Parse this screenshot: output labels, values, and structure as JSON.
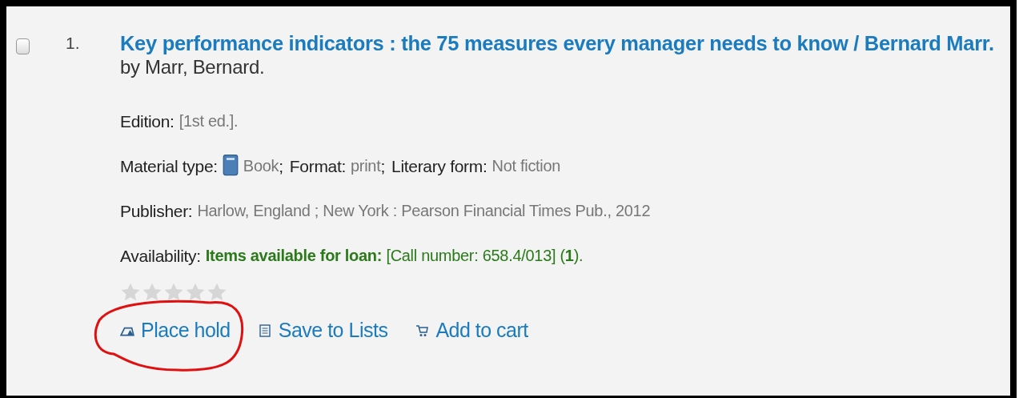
{
  "result": {
    "checked": false,
    "number": "1.",
    "title": "Key performance indicators : the 75 measures every manager needs to know / Bernard Marr.",
    "author": "by Marr, Bernard.",
    "details": [
      {
        "kind": "plain",
        "parts": [
          {
            "label": "Edition:",
            "value": "[1st ed.]."
          }
        ]
      },
      {
        "kind": "material",
        "parts": [
          {
            "label": "Material type:",
            "value": "Book",
            "sep": ";"
          },
          {
            "label": "Format:",
            "value": "print",
            "sep": " ;"
          },
          {
            "label": "Literary form:",
            "value": "Not fiction"
          }
        ]
      },
      {
        "kind": "plain",
        "parts": [
          {
            "label": "Publisher:",
            "value": "Harlow, England ; New York : Pearson Financial Times Pub., 2012"
          }
        ]
      },
      {
        "kind": "availability",
        "parts": [
          {
            "label": "Availability:",
            "value": "**Items available for loan:** [Call number: 658.4/013] (**1**)."
          }
        ]
      }
    ],
    "stars": 0,
    "actions": [
      {
        "kind": "hold",
        "label": "Place hold",
        "highlighted": true
      },
      {
        "kind": "list",
        "label": "Save to Lists",
        "highlighted": false
      },
      {
        "kind": "cart",
        "label": "Add to cart",
        "highlighted": false
      }
    ]
  }
}
